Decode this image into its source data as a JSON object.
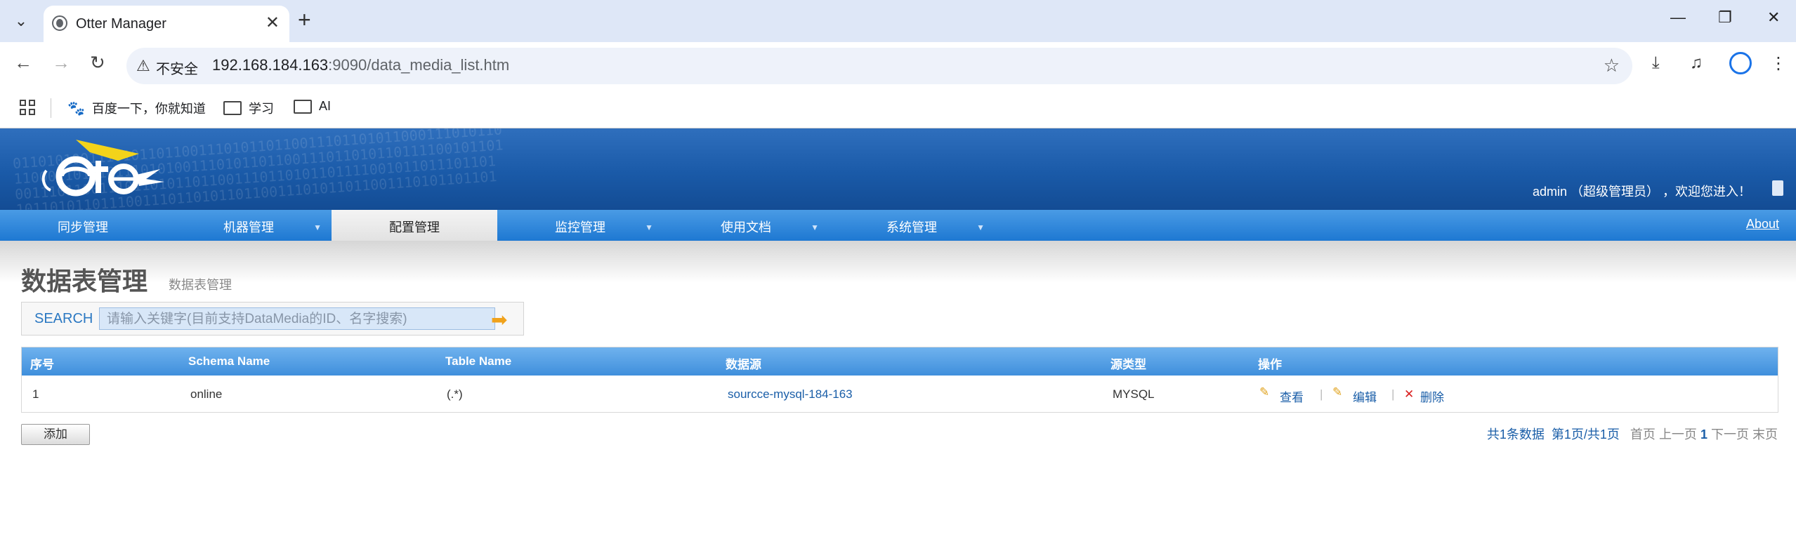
{
  "browser": {
    "tab_title": "Otter Manager",
    "tab_close": "✕",
    "new_tab": "+",
    "insecure_label": "不安全",
    "url_host": "192.168.184.163",
    "url_path": ":9090/data_media_list.htm",
    "bookmarks": [
      {
        "label": "百度一下，你就知道",
        "icon": "baidu-paw-icon"
      },
      {
        "label": "学习",
        "icon": "folder-icon"
      },
      {
        "label": "AI",
        "icon": "folder-icon"
      }
    ]
  },
  "header": {
    "welcome": "admin （超级管理员） ，欢迎您进入！"
  },
  "menu": {
    "items": [
      {
        "label": "同步管理",
        "dropdown": false,
        "active": false
      },
      {
        "label": "机器管理",
        "dropdown": true,
        "active": false
      },
      {
        "label": "配置管理",
        "dropdown": false,
        "active": true
      },
      {
        "label": "监控管理",
        "dropdown": true,
        "active": false
      },
      {
        "label": "使用文档",
        "dropdown": true,
        "active": false
      },
      {
        "label": "系统管理",
        "dropdown": true,
        "active": false
      }
    ],
    "about": "About"
  },
  "page": {
    "title": "数据表管理",
    "subtitle": "数据表管理"
  },
  "search": {
    "label": "SEARCH",
    "placeholder": "请输入关键字(目前支持DataMedia的ID、名字搜索)"
  },
  "table": {
    "columns": [
      "序号",
      "Schema Name",
      "Table Name",
      "数据源",
      "源类型",
      "操作"
    ],
    "rows": [
      {
        "id": "1",
        "schema": "online",
        "table": "(.*)",
        "source": "sourcce-mysql-184-163",
        "type": "MYSQL"
      }
    ],
    "actions": {
      "view": "查看",
      "edit": "编辑",
      "delete": "删除",
      "separator": "|"
    }
  },
  "footer": {
    "add_label": "添加",
    "total": "共1条数据",
    "page_info": "第1页/共1页",
    "first": "首页",
    "prev": "上一页",
    "current": "1",
    "next": "下一页",
    "last": "末页"
  },
  "colors": {
    "header_blue": "#1a5aa8",
    "menu_blue": "#1e78d2",
    "link_blue": "#1a5ea8"
  }
}
